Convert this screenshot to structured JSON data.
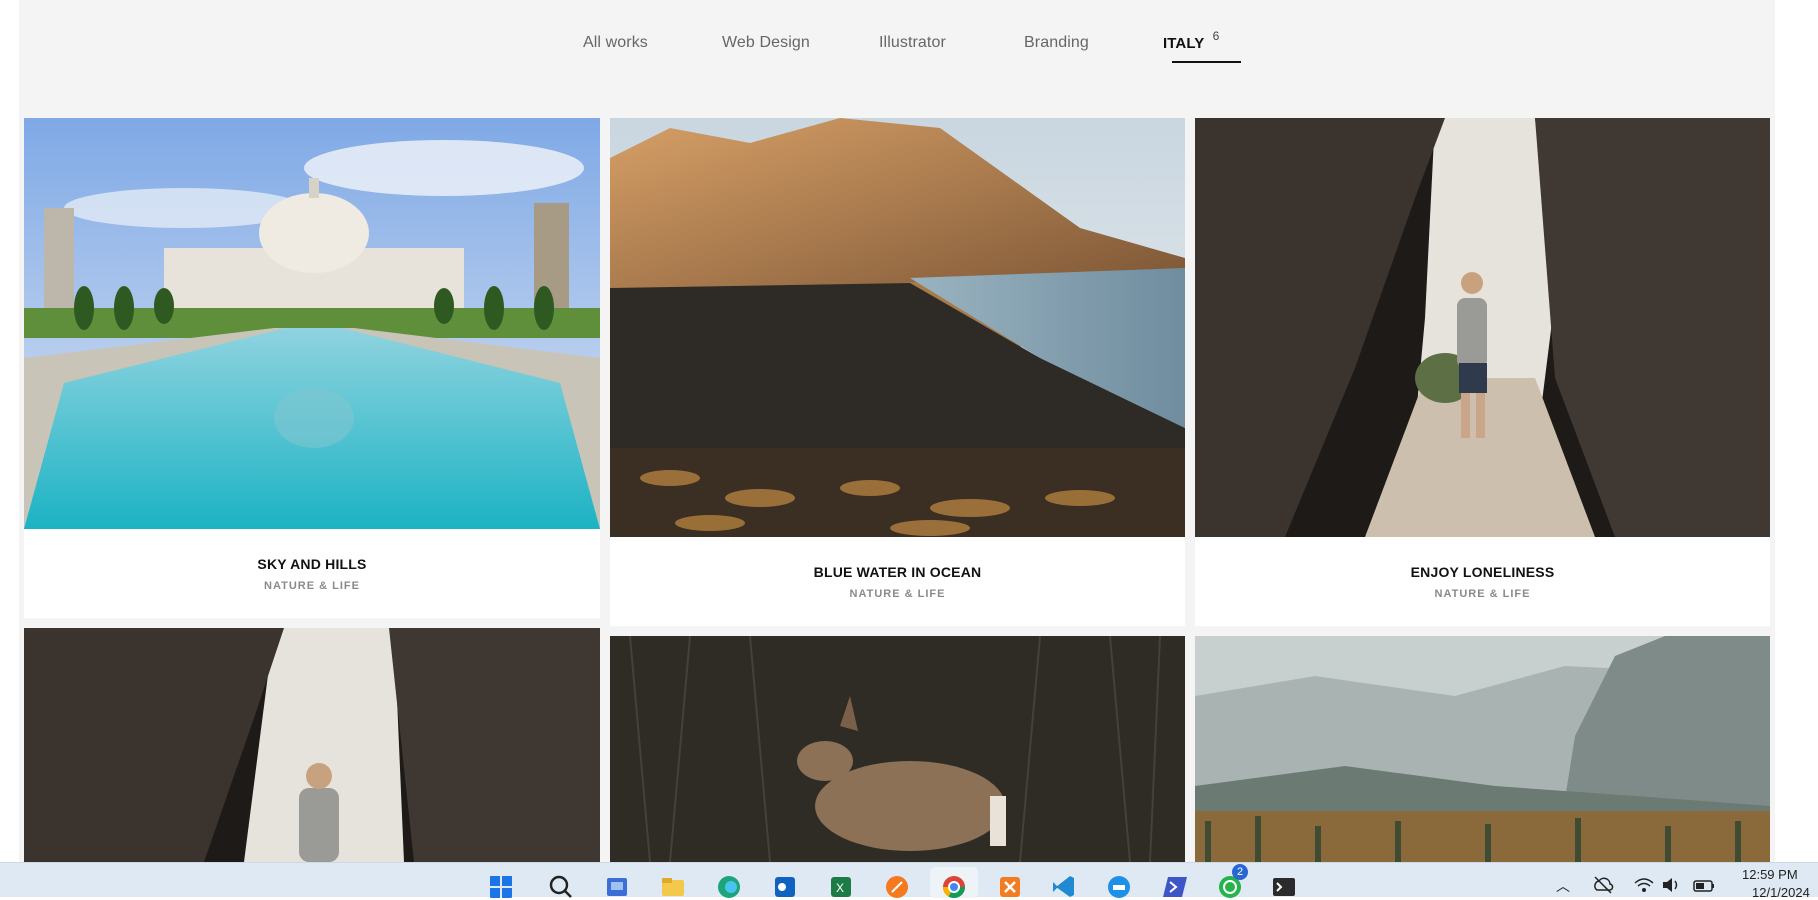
{
  "filters": [
    {
      "label": "All works"
    },
    {
      "label": "Web Design"
    },
    {
      "label": "Illustrator"
    },
    {
      "label": "Branding"
    },
    {
      "label": "ITALY",
      "count": "6",
      "active": true
    }
  ],
  "portfolio": [
    {
      "title": "SKY AND HILLS",
      "category": "NATURE & LIFE"
    },
    {
      "title": "BLUE WATER IN OCEAN",
      "category": "NATURE & LIFE"
    },
    {
      "title": "ENJOY LONELINESS",
      "category": "NATURE & LIFE"
    }
  ],
  "taskbar": {
    "apps": [
      "windows-start-icon",
      "search-icon",
      "ms-store-icon",
      "file-explorer-icon",
      "edge-icon",
      "outlook-icon",
      "excel-icon",
      "pen-tool-icon",
      "chrome-icon",
      "xampp-icon",
      "vscode-icon",
      "docker-icon",
      "powershell-icon",
      "whatsapp-icon",
      "terminal-icon"
    ],
    "whatsapp_badge": "2",
    "time": "12:59 PM",
    "date": "12/1/2024"
  }
}
